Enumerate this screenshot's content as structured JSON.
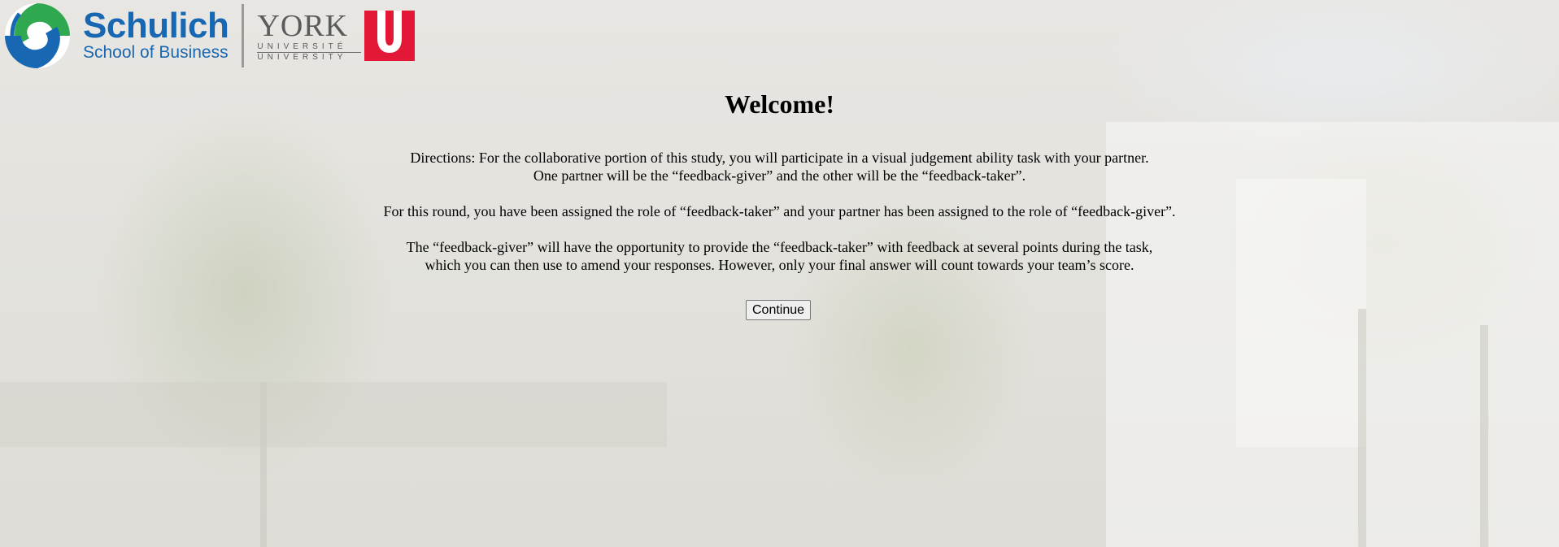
{
  "header": {
    "schulich_logo": {
      "name": "Schulich",
      "subtitle": "School of Business",
      "brand_blue": "#1767b2",
      "brand_green": "#2fa84f"
    },
    "york_logo": {
      "name": "YORK",
      "line1": "UNIVERSITÉ",
      "line2": "UNIVERSITY",
      "brand_red": "#e31837"
    }
  },
  "main": {
    "title": "Welcome!",
    "directions": [
      "Directions: For the collaborative portion of this study, you will participate in a visual judgement ability task with your partner.",
      "One partner will be the “feedback-giver” and the other will be the “feedback-taker”."
    ],
    "role_assignment": "For this round, you have been assigned the role of “feedback-taker” and your partner has been assigned to the role of “feedback-giver”.",
    "feedback_info": [
      "The “feedback-giver” will have the opportunity to provide the “feedback-taker” with feedback at several points during the task,",
      "which you can then use to amend your responses. However, only your final answer will count towards your team’s score."
    ],
    "continue_label": "Continue"
  }
}
